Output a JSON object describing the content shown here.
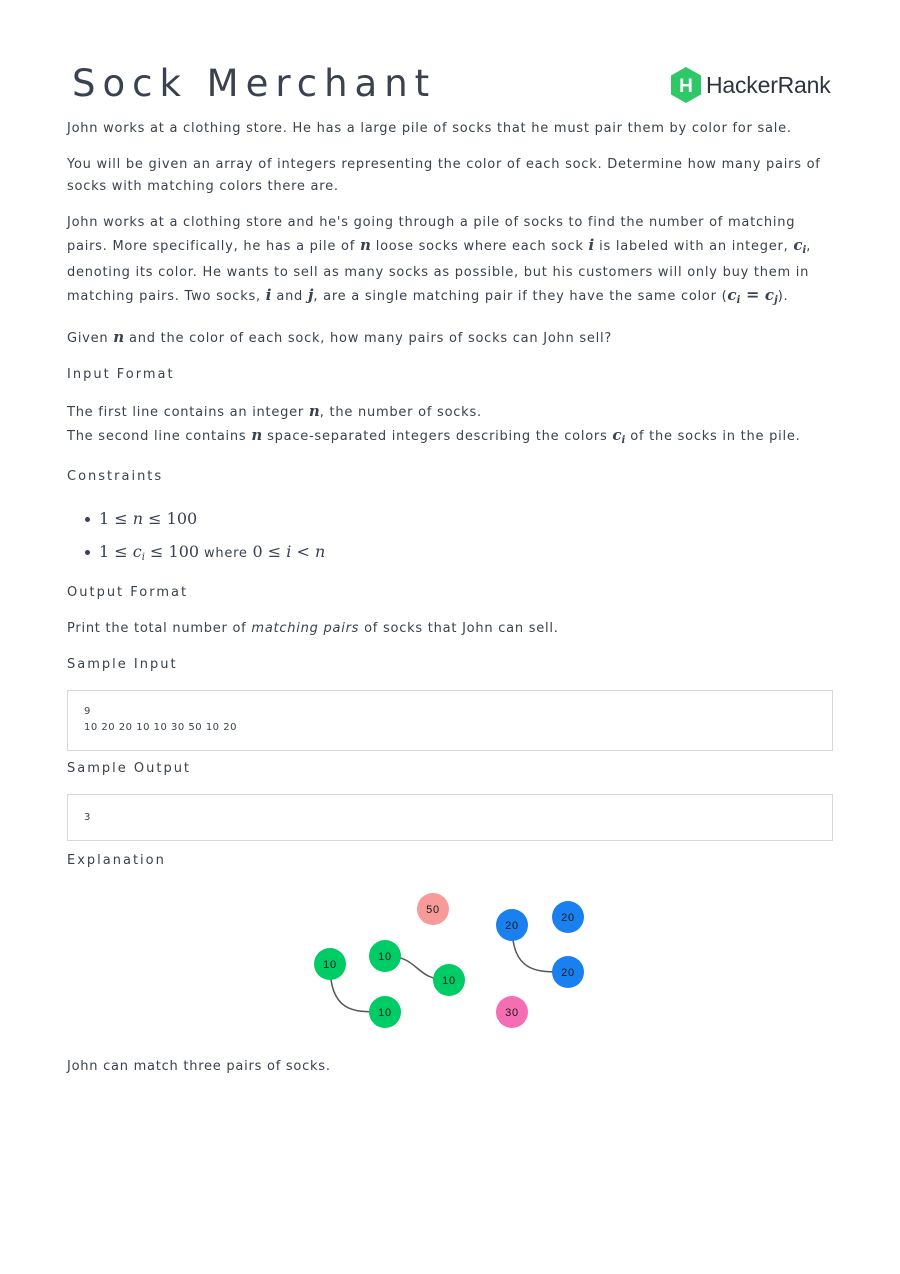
{
  "title": "Sock Merchant",
  "brand": {
    "logo_letter": "H",
    "name": "HackerRank",
    "logo_color": "#2ec866"
  },
  "body": {
    "p1": "John works at a clothing store. He has a large pile of socks that he must pair them by color for sale.",
    "p2": "You will be given an array of integers representing the color of each sock. Determine how many pairs of socks with matching colors there are.",
    "p3": {
      "a": "John works at a clothing store and he's going through a pile of socks to find the number of matching pairs. More specifically, he has a pile of ",
      "n": "n",
      "b": " loose socks where each sock ",
      "i": "i",
      "c": " is labeled with an integer, ",
      "ci": "c",
      "ci_sub": "i",
      "d": ", denoting its color. He wants to sell as many socks as possible, but his customers will only buy them in matching pairs. Two socks, ",
      "i2": "i",
      "e": " and ",
      "j": "j",
      "f": ", are a single matching pair if they have the same color (",
      "eq_c1": "c",
      "eq_s1": "i",
      "eq_op": " = ",
      "eq_c2": "c",
      "eq_s2": "j",
      "g": ")."
    },
    "p4": {
      "a": "Given ",
      "n": "n",
      "b": " and the color of each sock, how many pairs of socks can John sell?"
    }
  },
  "input_format": {
    "heading": "Input Format",
    "l1_a": "The first line contains an integer ",
    "l1_n": "n",
    "l1_b": ", the number of socks.",
    "l2_a": "The second line contains ",
    "l2_n": "n",
    "l2_b": " space-separated integers describing the colors ",
    "l2_c": "c",
    "l2_cs": "i",
    "l2_d": " of the socks in the pile."
  },
  "constraints": {
    "heading": "Constraints",
    "c1": {
      "lo": "1",
      "le1": " ≤ ",
      "var": "n",
      "le2": " ≤ ",
      "hi": "100"
    },
    "c2": {
      "lo": "1",
      "le1": " ≤ ",
      "var": "c",
      "sub": "i",
      "le2": " ≤ ",
      "hi": "100",
      "where": " where ",
      "zero": "0",
      "le3": " ≤ ",
      "idx": "i",
      "lt": " < ",
      "n": "n"
    }
  },
  "output_format": {
    "heading": "Output Format",
    "a": "Print the total number of ",
    "em": "matching pairs",
    "b": " of socks that John can sell."
  },
  "sample_input": {
    "heading": "Sample Input",
    "line1": "9",
    "line2": "10 20 20 10 10 30 50 10 20"
  },
  "sample_output": {
    "heading": "Sample Output",
    "line1": "3"
  },
  "explanation": {
    "heading": "Explanation",
    "socks": [
      {
        "label": "50",
        "color": "#f89a9a"
      },
      {
        "label": "20",
        "color": "#1a7fef"
      },
      {
        "label": "20",
        "color": "#1a7fef"
      },
      {
        "label": "10",
        "color": "#00cc66"
      },
      {
        "label": "10",
        "color": "#00cc66"
      },
      {
        "label": "10",
        "color": "#00cc66"
      },
      {
        "label": "20",
        "color": "#1a7fef"
      },
      {
        "label": "10",
        "color": "#00cc66"
      },
      {
        "label": "30",
        "color": "#f56eb4"
      }
    ],
    "pairs": [
      [
        1,
        6
      ],
      [
        4,
        5
      ],
      [
        3,
        7
      ]
    ],
    "text": "John can match three pairs of socks."
  }
}
